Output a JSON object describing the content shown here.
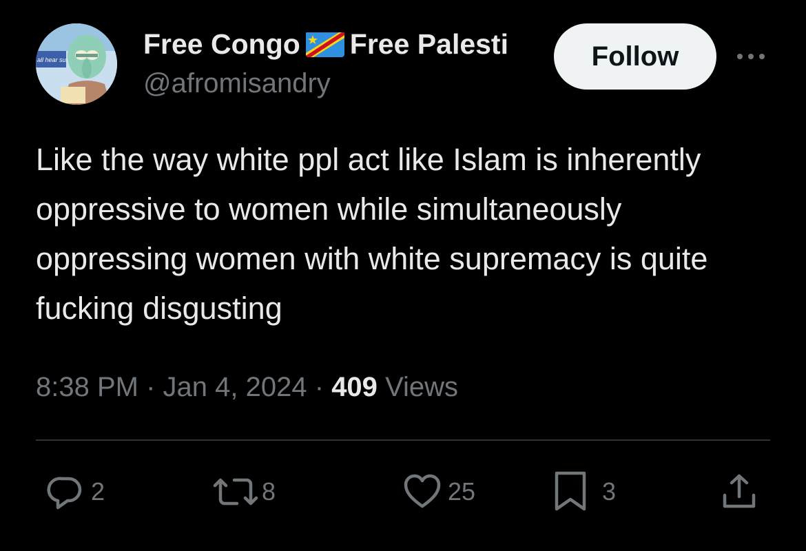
{
  "author": {
    "display_name_part1": "Free Congo",
    "flag_icon": "flag-drc-icon",
    "display_name_part2": "Free Palesti",
    "handle": "@afromisandry",
    "avatar_caption": "all hear sumn?.."
  },
  "follow_label": "Follow",
  "more_icon": "more-horizontal-icon",
  "tweet": {
    "text": "Like the way white ppl act like Islam is inherently oppressive to women while simultaneously oppressing women with white supremacy is quite fucking disgusting",
    "time": "8:38 PM",
    "date": "Jan 4, 2024",
    "views_count": "409",
    "views_label": "Views",
    "separator": "·"
  },
  "actions": {
    "reply": {
      "icon": "reply-icon",
      "count": "2"
    },
    "retweet": {
      "icon": "retweet-icon",
      "count": "8"
    },
    "like": {
      "icon": "heart-icon",
      "count": "25"
    },
    "bookmark": {
      "icon": "bookmark-icon",
      "count": "3"
    },
    "share": {
      "icon": "share-icon"
    }
  },
  "colors": {
    "background": "#000000",
    "primary_text": "#e7e9ea",
    "secondary_text": "#71767b",
    "divider": "#2f3336",
    "follow_button_bg": "#eff3f4",
    "follow_button_text": "#0f1419"
  }
}
